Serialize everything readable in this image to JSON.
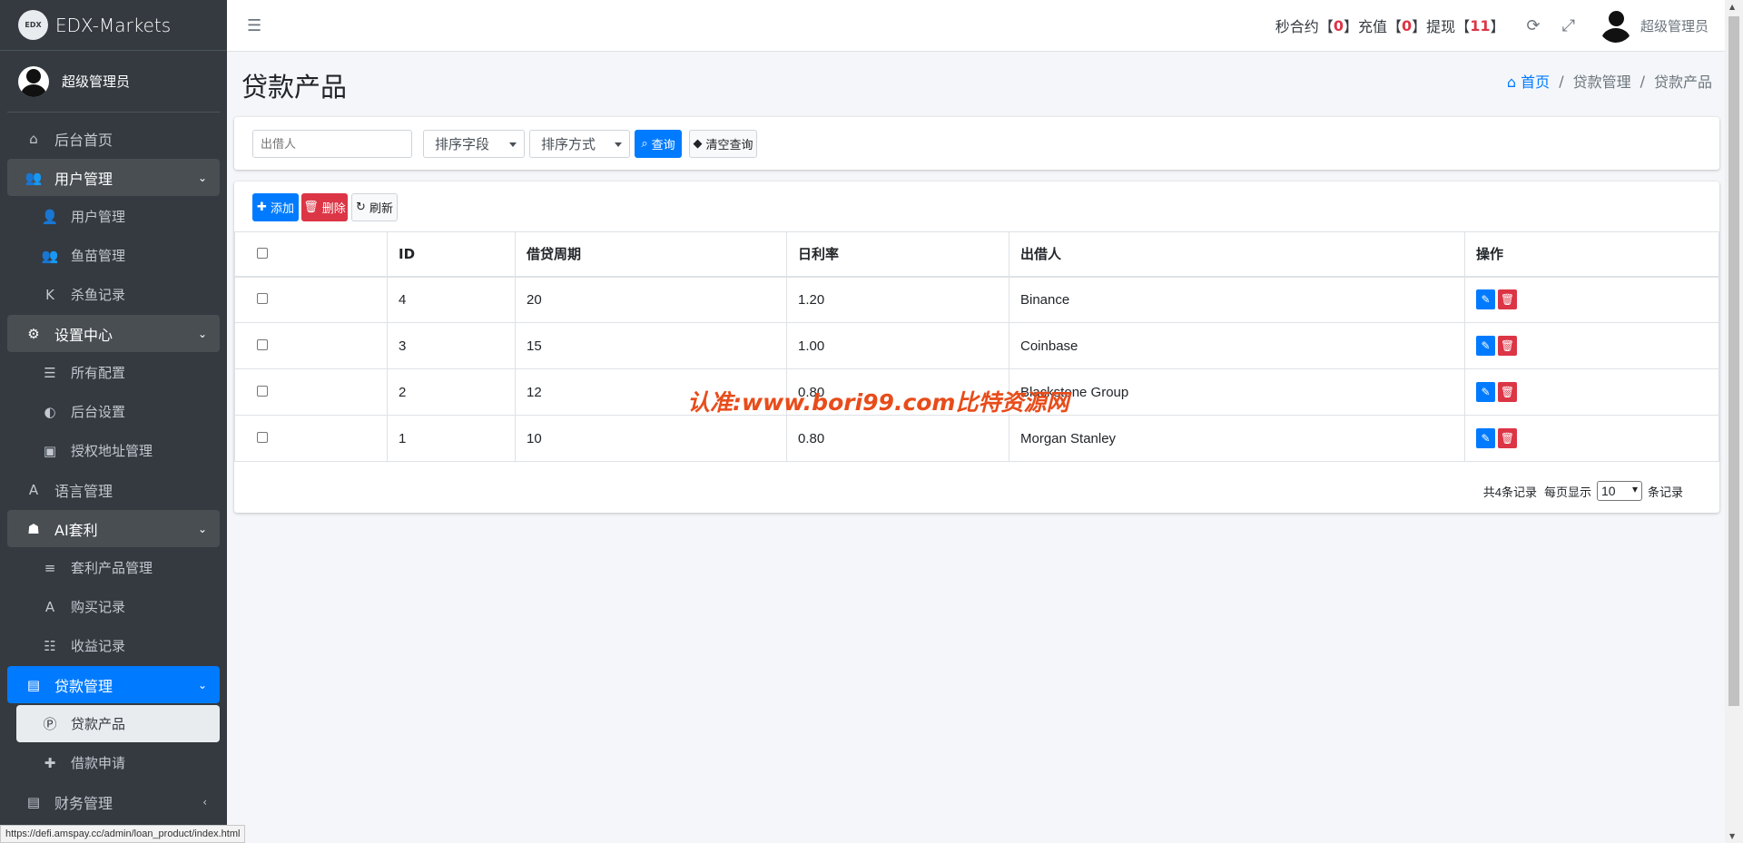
{
  "brand": {
    "logo": "EDX",
    "name": "EDX-Markets"
  },
  "user": {
    "name": "超级管理员"
  },
  "sidebar": {
    "items": [
      {
        "label": "后台首页",
        "icon": "home-icon",
        "glyph": "⌂",
        "type": "top"
      },
      {
        "label": "用户管理",
        "icon": "users-icon",
        "glyph": "👥",
        "type": "group-open"
      },
      {
        "label": "用户管理",
        "icon": "user-icon",
        "glyph": "👤",
        "type": "sub"
      },
      {
        "label": "鱼苗管理",
        "icon": "users-icon",
        "glyph": "👥",
        "type": "sub"
      },
      {
        "label": "杀鱼记录",
        "icon": "k-icon",
        "glyph": "K",
        "type": "sub"
      },
      {
        "label": "设置中心",
        "icon": "cogs-icon",
        "glyph": "⚙",
        "type": "group-open"
      },
      {
        "label": "所有配置",
        "icon": "list-icon",
        "glyph": "☰",
        "type": "sub"
      },
      {
        "label": "后台设置",
        "icon": "adjust-icon",
        "glyph": "◐",
        "type": "sub"
      },
      {
        "label": "授权地址管理",
        "icon": "address-book-icon",
        "glyph": "▣",
        "type": "sub"
      },
      {
        "label": "语言管理",
        "icon": "language-icon",
        "glyph": "A",
        "type": "top"
      },
      {
        "label": "AI套利",
        "icon": "android-icon",
        "glyph": "☗",
        "type": "group-open"
      },
      {
        "label": "套利产品管理",
        "icon": "bars-icon",
        "glyph": "≡",
        "type": "sub"
      },
      {
        "label": "购买记录",
        "icon": "font-icon",
        "glyph": "A",
        "type": "sub"
      },
      {
        "label": "收益记录",
        "icon": "tasks-icon",
        "glyph": "☷",
        "type": "sub"
      },
      {
        "label": "贷款管理",
        "icon": "money-icon",
        "glyph": "▤",
        "type": "group-active"
      },
      {
        "label": "贷款产品",
        "icon": "product-hunt-icon",
        "glyph": "Ⓟ",
        "type": "current"
      },
      {
        "label": "借款申请",
        "icon": "ambulance-icon",
        "glyph": "✚",
        "type": "sub"
      },
      {
        "label": "财务管理",
        "icon": "money-icon",
        "glyph": "▤",
        "type": "group-closed"
      }
    ]
  },
  "header": {
    "stats": [
      {
        "label": "秒合约",
        "value": "0"
      },
      {
        "label": "充值",
        "value": "0"
      },
      {
        "label": "提现",
        "value": "11"
      }
    ],
    "user": "超级管理员"
  },
  "page": {
    "title": "贷款产品",
    "breadcrumb": [
      "首页",
      "贷款管理",
      "贷款产品"
    ]
  },
  "search": {
    "placeholder": "出借人",
    "sort_field": "排序字段",
    "sort_order": "排序方式",
    "query_button": "查询",
    "clear_button": "清空查询"
  },
  "toolbar": {
    "add": "添加",
    "delete": "删除",
    "refresh": "刷新"
  },
  "table": {
    "headers": [
      "",
      "ID",
      "借贷周期",
      "日利率",
      "出借人",
      "操作"
    ],
    "rows": [
      {
        "id": "4",
        "period": "20",
        "rate": "1.20",
        "lender": "Binance"
      },
      {
        "id": "3",
        "period": "15",
        "rate": "1.00",
        "lender": "Coinbase"
      },
      {
        "id": "2",
        "period": "12",
        "rate": "0.80",
        "lender": "Blackstone Group"
      },
      {
        "id": "1",
        "period": "10",
        "rate": "0.80",
        "lender": "Morgan Stanley"
      }
    ]
  },
  "pagination": {
    "total": "共4条记录",
    "per_page_label": "每页显示",
    "per_page": "10",
    "unit": "条记录"
  },
  "watermark": "认准:www.bori99.com比特资源网",
  "status_url": "https://defi.amspay.cc/admin/loan_product/index.html"
}
